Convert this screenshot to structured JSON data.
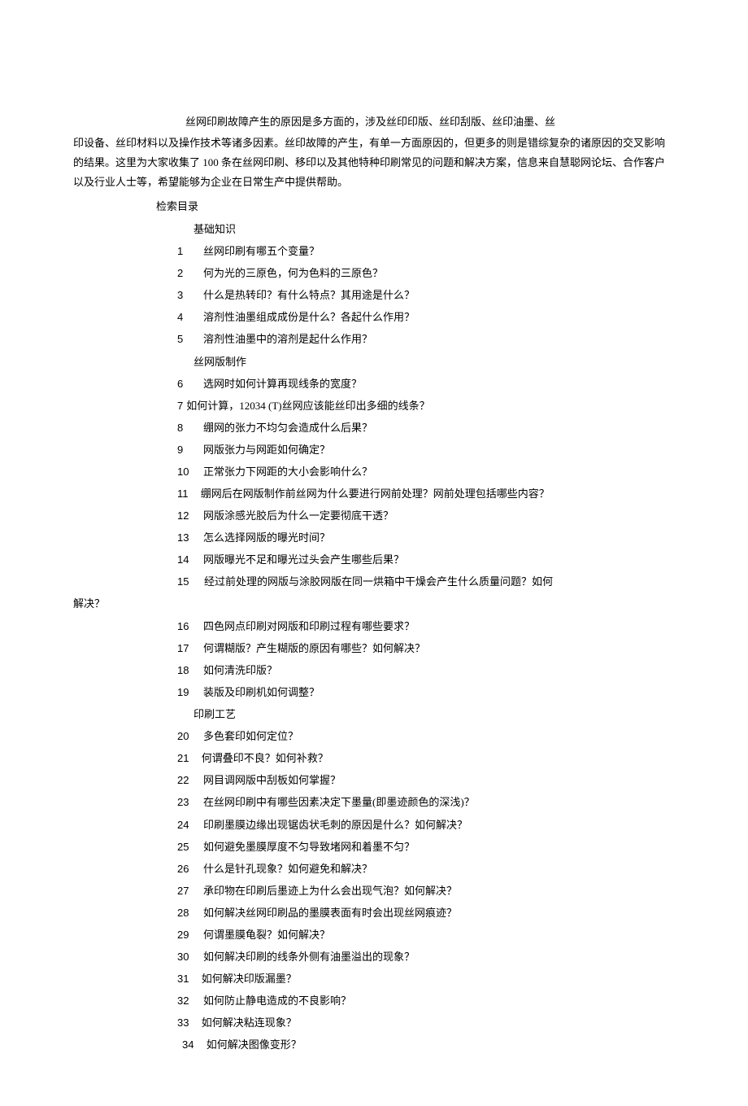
{
  "intro": {
    "line1": "丝网印刷故障产生的原因是多方面的，涉及丝印印版、丝印刮版、丝印油墨、丝",
    "rest": "印设备、丝印材料以及操作技术等诸多因素。丝印故障的产生，有单一方面原因的，但更多的则是错综复杂的诸原因的交叉影响的结果。这里为大家收集了 100 条在丝网印刷、移印以及其他特种印刷常见的问题和解决方案，信息来自慧聪网论坛、合作客户以及行业人士等，希望能够为企业在日常生产中提供帮助。"
  },
  "toc_title": "检索目录",
  "sections": {
    "basics": "基础知识",
    "plate": "丝网版制作",
    "process": "印刷工艺"
  },
  "items": {
    "i1": {
      "num": "1",
      "text": "丝网印刷有哪五个变量？"
    },
    "i2": {
      "num": "2",
      "text": "何为光的三原色，何为色料的三原色？"
    },
    "i3": {
      "num": "3",
      "text": "什么是热转印？有什么特点？其用途是什么？"
    },
    "i4": {
      "num": "4",
      "text": "溶剂性油墨组成成份是什么？各起什么作用？"
    },
    "i5": {
      "num": "5",
      "text": "溶剂性油墨中的溶剂是起什么作用？"
    },
    "i6": {
      "num": "6",
      "text": "选网时如何计算再现线条的宽度？"
    },
    "i7": {
      "num": "7",
      "text": "如何计算，12034 (T)丝网应该能丝印出多细的线条？"
    },
    "i8": {
      "num": "8",
      "text": "绷网的张力不均匀会造成什么后果？"
    },
    "i9": {
      "num": "9",
      "text": "网版张力与网距如何确定？"
    },
    "i10": {
      "num": "10",
      "text": "正常张力下网距的大小会影响什么？"
    },
    "i11": {
      "num": "11",
      "text": "绷网后在网版制作前丝网为什么要进行网前处理？网前处理包括哪些内容？"
    },
    "i12": {
      "num": "12",
      "text": "网版涂感光胶后为什么一定要彻底干透？"
    },
    "i13": {
      "num": "13",
      "text": "怎么选择网版的曝光时间？"
    },
    "i14": {
      "num": "14",
      "text": "网版曝光不足和曝光过头会产生哪些后果？"
    },
    "i15": {
      "num": "15",
      "text": "经过前处理的网版与涂胶网版在同一烘箱中干燥会产生什么质量问题？如何"
    },
    "i16": {
      "num": "16",
      "text": "四色网点印刷对网版和印刷过程有哪些要求？"
    },
    "i17": {
      "num": "17",
      "text": "何谓糊版？产生糊版的原因有哪些？如何解决？"
    },
    "i18": {
      "num": "18",
      "text": "如何清洗印版？"
    },
    "i19": {
      "num": "19",
      "text": "装版及印刷机如何调整？"
    },
    "i20": {
      "num": "20",
      "text": "多色套印如何定位？"
    },
    "i21": {
      "num": "21",
      "text": "何谓叠印不良？如何补救？"
    },
    "i22": {
      "num": "22",
      "text": "网目调网版中刮板如何掌握？"
    },
    "i23": {
      "num": "23",
      "text": "在丝网印刷中有哪些因素决定下墨量(即墨迹颜色的深浅)？"
    },
    "i24": {
      "num": "24",
      "text": "印刷墨膜边缘出现锯齿状毛刺的原因是什么？如何解决？"
    },
    "i25": {
      "num": "25",
      "text": "如何避免墨膜厚度不匀导致堵网和着墨不匀？"
    },
    "i26": {
      "num": "26",
      "text": "什么是针孔现象？如何避免和解决？"
    },
    "i27": {
      "num": "27",
      "text": "承印物在印刷后墨迹上为什么会出现气泡？如何解决？"
    },
    "i28": {
      "num": "28",
      "text": "如何解决丝网印刷品的墨膜表面有时会出现丝网痕迹？"
    },
    "i29": {
      "num": "29",
      "text": "何谓墨膜龟裂？如何解决？"
    },
    "i30": {
      "num": "30",
      "text": "如何解决印刷的线条外侧有油墨溢出的现象？"
    },
    "i31": {
      "num": "31",
      "text": "如何解决印版漏墨？"
    },
    "i32": {
      "num": "32",
      "text": "如何防止静电造成的不良影响？"
    },
    "i33": {
      "num": "33",
      "text": "如何解决粘连现象？"
    },
    "i34": {
      "num": "34",
      "text": "如何解决图像变形？"
    }
  },
  "solve": "解决？"
}
